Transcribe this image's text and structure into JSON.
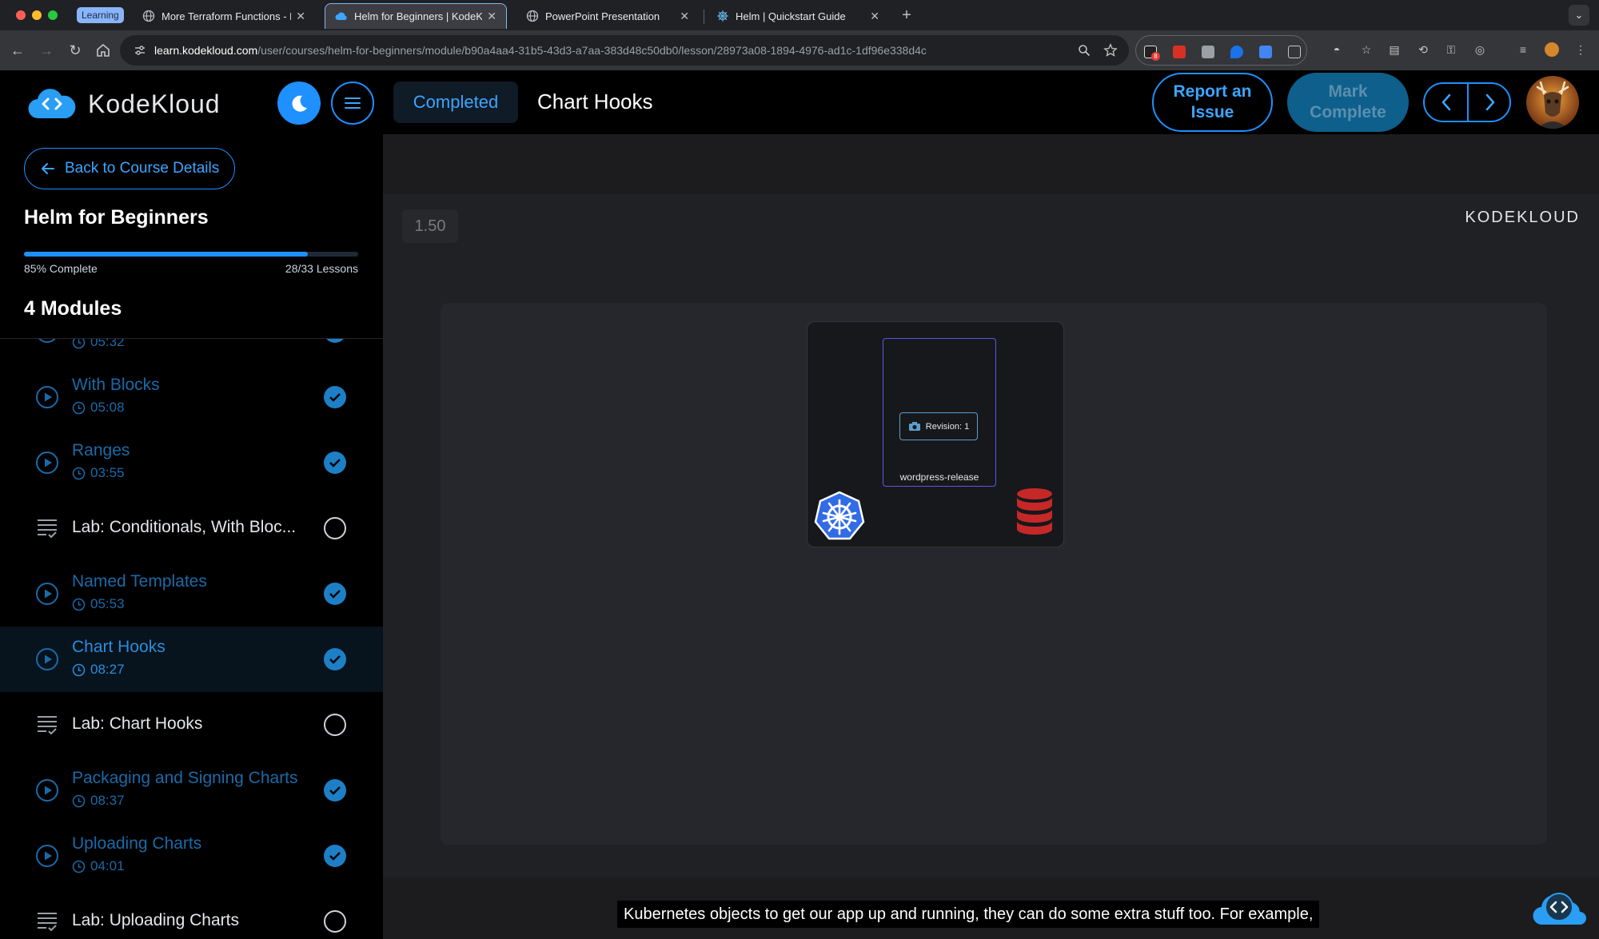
{
  "browser": {
    "group_label": "Learning",
    "tabs": [
      {
        "title": "More Terraform Functions - K",
        "active": false
      },
      {
        "title": "Helm for Beginners | KodeKlo",
        "active": true
      },
      {
        "title": "PowerPoint Presentation",
        "active": false
      },
      {
        "title": "Helm | Quickstart Guide",
        "active": false
      }
    ],
    "url_host": "learn.kodekloud.com",
    "url_path": "/user/courses/helm-for-beginners/module/b90a4aa4-31b5-43d3-a7aa-383d48c50db0/lesson/28973a08-1894-4976-ad1c-1df96e338d4c",
    "extension_badge": "8"
  },
  "header": {
    "brand": "KodeKloud",
    "status": "Completed",
    "lesson_title": "Chart Hooks",
    "report_button": "Report an Issue",
    "mark_button": "Mark Complete"
  },
  "sidebar": {
    "back_label": "Back to Course Details",
    "course_title": "Helm for Beginners",
    "progress": {
      "fraction": 0.85,
      "percent_label": "85% Complete",
      "lessons_label": "28/33 Lessons"
    },
    "modules_title": "4 Modules",
    "items": [
      {
        "name": "",
        "duration": "05:32",
        "kind": "video",
        "done": true
      },
      {
        "name": "With Blocks",
        "duration": "05:08",
        "kind": "video",
        "done": true
      },
      {
        "name": "Ranges",
        "duration": "03:55",
        "kind": "video",
        "done": true
      },
      {
        "name": "Lab: Conditionals, With Bloc...",
        "duration": "",
        "kind": "lab",
        "done": false
      },
      {
        "name": "Named Templates",
        "duration": "05:53",
        "kind": "video",
        "done": true
      },
      {
        "name": "Chart Hooks",
        "duration": "08:27",
        "kind": "video",
        "done": true,
        "current": true
      },
      {
        "name": "Lab: Chart Hooks",
        "duration": "",
        "kind": "lab",
        "done": false
      },
      {
        "name": "Packaging and Signing Charts",
        "duration": "08:37",
        "kind": "video",
        "done": true
      },
      {
        "name": "Uploading Charts",
        "duration": "04:01",
        "kind": "video",
        "done": true
      },
      {
        "name": "Lab: Uploading Charts",
        "duration": "",
        "kind": "lab",
        "done": false
      }
    ]
  },
  "video": {
    "speed": "1.50",
    "watermark": "KODEKLOUD",
    "revision_label": "Revision: 1",
    "release_name": "wordpress-release",
    "caption": "Kubernetes objects to get our app up and running, they can do some extra stuff too. For example,"
  },
  "colors": {
    "accent": "#1e90ff",
    "release_border": "#5b57e8",
    "db_red": "#c62828",
    "k8s_blue": "#326ce5"
  }
}
